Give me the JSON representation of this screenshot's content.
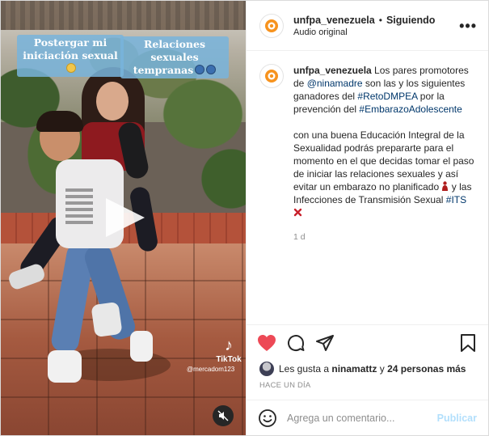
{
  "media": {
    "caption_left": "Postergar mi iniciación sexual",
    "caption_right": "Relaciones sexuales tempranas",
    "tiktok_brand": "TikTok",
    "tiktok_handle": "@mercadom123"
  },
  "header": {
    "username": "unfpa_venezuela",
    "separator": "•",
    "follow_status": "Siguiendo",
    "audio": "Audio original",
    "more": "•••"
  },
  "caption": {
    "username": "unfpa_venezuela",
    "p1_a": "Los pares promotores de ",
    "mention": "@ninamadre",
    "p1_b": " son las y los siguientes ganadores del ",
    "tag1": "#RetoDMPEA",
    "p1_c": " por la prevención del ",
    "tag2": "#EmbarazoAdolescente",
    "p2_a": "con una buena Educación Integral de la Sexualidad podrás prepararte para el momento en el que decidas tomar el paso de iniciar las relaciones sexuales y así evitar un embarazo no planificado ",
    "p2_b": " y las Infecciones de Transmisión Sexual ",
    "tag3": "#ITS",
    "age": "1 d"
  },
  "likes": {
    "prefix": "Les gusta a ",
    "user": "ninamattz",
    "mid": " y ",
    "others": "24 personas más"
  },
  "timestamp": "HACE UN DÍA",
  "comment_box": {
    "placeholder": "Agrega un comentario...",
    "publish": "Publicar"
  },
  "colors": {
    "like_red": "#ed4956",
    "link_blue": "#00376b",
    "publish_disabled": "#b2dffc",
    "unfpa_orange": "#f7931e"
  }
}
